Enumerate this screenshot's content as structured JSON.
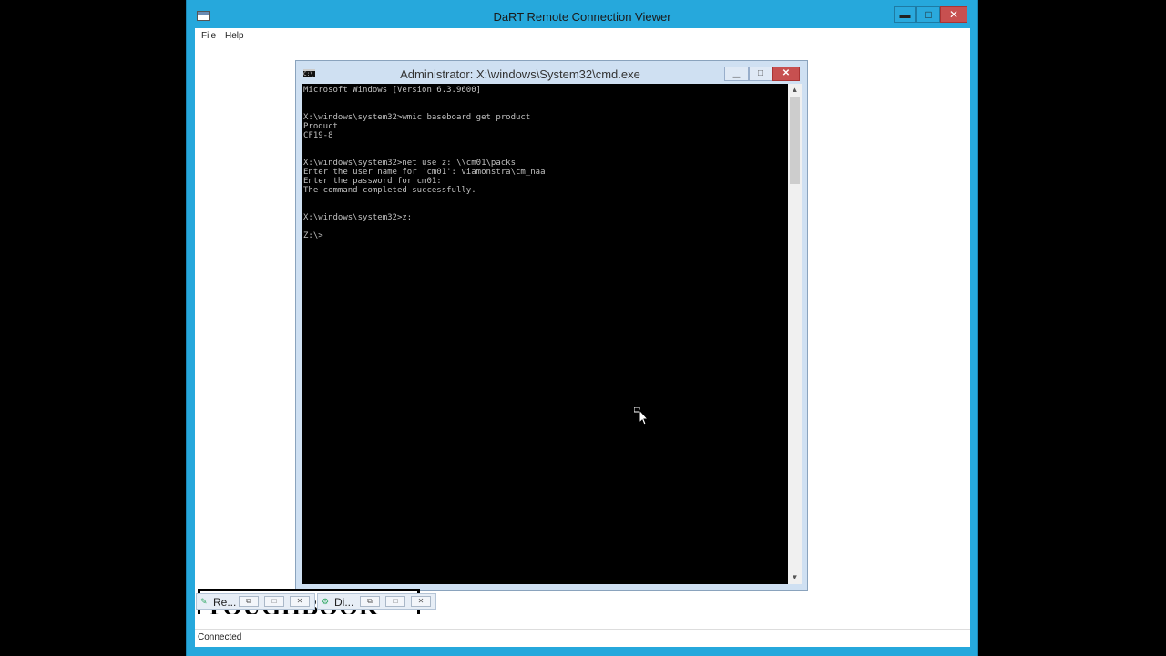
{
  "outer_window": {
    "title": "DaRT Remote Connection Viewer",
    "controls": {
      "minimize": "▬",
      "maximize": "□",
      "close": "✕"
    }
  },
  "menu": {
    "file": "File",
    "help": "Help"
  },
  "cmd_window": {
    "title": "Administrator: X:\\windows\\System32\\cmd.exe",
    "icon_label": "C:\\",
    "controls": {
      "minimize": "▁",
      "maximize": "□",
      "close": "✕"
    },
    "lines": [
      "Microsoft Windows [Version 6.3.9600]",
      "",
      "",
      "X:\\windows\\system32>wmic baseboard get product",
      "Product",
      "CF19-8",
      "",
      "",
      "X:\\windows\\system32>net use z: \\\\cm01\\packs",
      "Enter the user name for 'cm01': viamonstra\\cm_naa",
      "Enter the password for cm01:",
      "The command completed successfully.",
      "",
      "",
      "X:\\windows\\system32>z:",
      "",
      "Z:\\>"
    ],
    "scroll_up": "▲",
    "scroll_down": "▼"
  },
  "logo": {
    "text": "TOUGHBOOK"
  },
  "taskbar": {
    "items": [
      {
        "label": "Re...",
        "icon": "remote-viewer-icon",
        "ctrl_restore": "⧉",
        "ctrl_max": "□",
        "ctrl_close": "✕"
      },
      {
        "label": "Di...",
        "icon": "diagnostics-icon",
        "ctrl_restore": "⧉",
        "ctrl_max": "□",
        "ctrl_close": "✕"
      }
    ]
  },
  "status": {
    "text": "Connected"
  },
  "colors": {
    "title_bar": "#26a8dc",
    "console_bg": "#000000",
    "console_text": "#c0c0c0",
    "close_button": "#c75050"
  }
}
